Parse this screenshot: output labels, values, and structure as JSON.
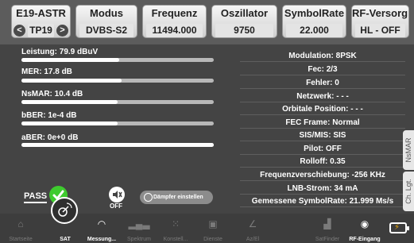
{
  "header": {
    "cells": [
      {
        "title": "E19-ASTR",
        "value": "TP19"
      },
      {
        "title": "Modus",
        "value": "DVBS-S2"
      },
      {
        "title": "Frequenz",
        "value": "11494.000"
      },
      {
        "title": "Oszillator",
        "value": "9750"
      },
      {
        "title": "SymbolRate",
        "value": "22.000"
      },
      {
        "title": "RF-Versorg...",
        "value": "HL - OFF"
      }
    ],
    "prev_arrow": "<",
    "next_arrow": ">"
  },
  "meters": [
    {
      "label": "Leistung: 79.9 dBuV",
      "level": 0.51
    },
    {
      "label": "MER: 17.8 dB",
      "level": 0.52
    },
    {
      "label": "NsMAR: 10.4 dB",
      "level": 0.5
    },
    {
      "label": "bBER: 1e-4 dB",
      "level": 0.5
    },
    {
      "label": "aBER: 0e+0 dB",
      "level": 1.0
    }
  ],
  "info": [
    "Modulation: 8PSK",
    "Fec: 2/3",
    "Fehler: 0",
    "Netzwerk: - - -",
    "Orbitale Position: - - -",
    "FEC Frame: Normal",
    "SIS/MIS: SIS",
    "Pilot: OFF",
    "Rolloff: 0.35",
    "Frequenzverschiebung: -256 KHz",
    "LNB-Strom: 34 mA",
    "Gemessene SymbolRate: 21.999 Ms/s"
  ],
  "status": {
    "pass_label": "PASS",
    "off_label": "OFF",
    "damper_label": "Dämpfer einstellen"
  },
  "side_tabs": [
    "NsMAR",
    "Ch. Lgt."
  ],
  "bottom_nav": [
    {
      "label": "Startseite",
      "icon": "home-icon"
    },
    {
      "label": "SAT",
      "icon": "satellite-icon",
      "active": true
    },
    {
      "label": "Messung...",
      "icon": "gauge-icon",
      "active": true
    },
    {
      "label": "Spektrum",
      "icon": "spectrum-icon"
    },
    {
      "label": "Konstell...",
      "icon": "constellation-icon"
    },
    {
      "label": "Dienste",
      "icon": "services-icon"
    },
    {
      "label": "Az/El",
      "icon": "azimuth-icon"
    },
    {
      "label": "SatFinder",
      "icon": "satfinder-icon"
    },
    {
      "label": "RF-Eingang",
      "icon": "rf-input-icon",
      "active": true
    }
  ],
  "colors": {
    "pass": "#3ecb2e",
    "battery_bolt": "#f0a800"
  }
}
